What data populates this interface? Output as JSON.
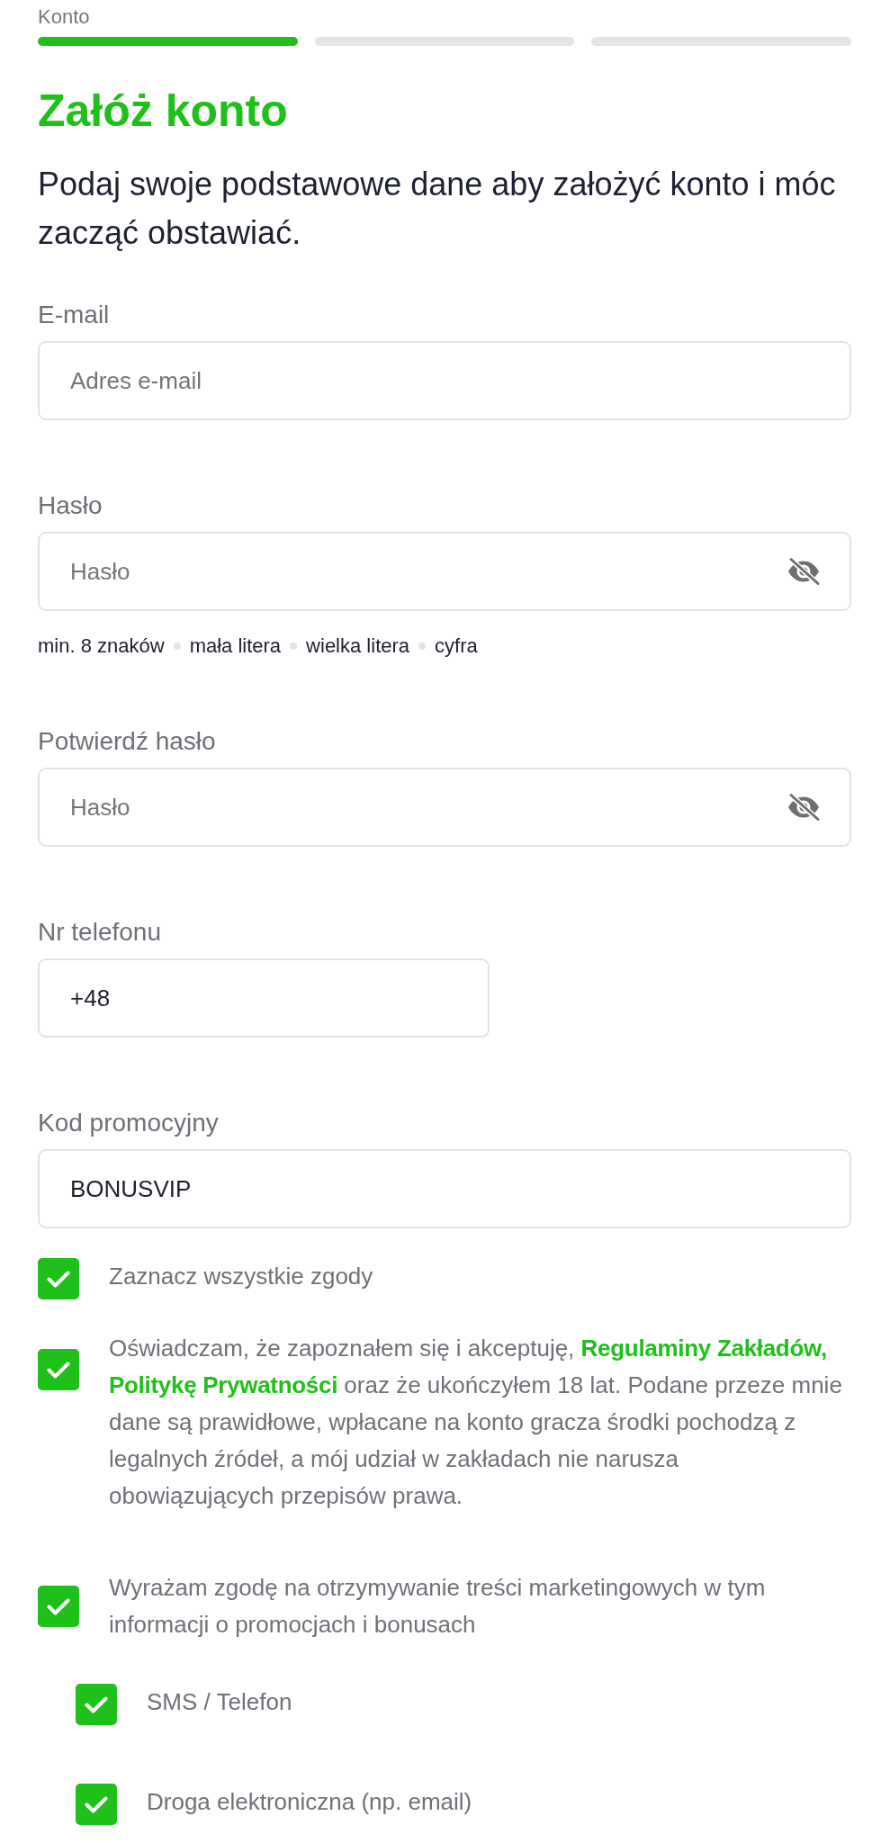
{
  "progress": {
    "label": "Konto",
    "steps": [
      {
        "active": true
      },
      {
        "active": false
      },
      {
        "active": false
      }
    ]
  },
  "title": "Załóż konto",
  "subtitle": "Podaj swoje podstawowe dane aby założyć konto i móc zacząć obstawiać.",
  "fields": [
    {
      "kind": "email",
      "label": "E-mail",
      "placeholder": "Adres e-mail"
    },
    {
      "kind": "password",
      "label": "Hasło",
      "placeholder": "Hasło",
      "hints": [
        "min. 8 znaków",
        "mała litera",
        "wielka litera",
        "cyfra"
      ]
    },
    {
      "kind": "password",
      "label": "Potwierdź hasło",
      "placeholder": "Hasło"
    },
    {
      "kind": "phone",
      "label": "Nr telefonu",
      "value": "+48"
    },
    {
      "kind": "code",
      "label": "Kod promocyjny",
      "value": "BONUSVIP"
    }
  ],
  "select_all": {
    "label": "Zaznacz wszystkie zgody",
    "checked": true
  },
  "consents": [
    {
      "checked": true,
      "segments": [
        {
          "kind": "text",
          "text": "Oświadczam, że zapoznałem się i akceptuję,"
        },
        {
          "kind": "link",
          "text": "Regulaminy Zakładów,"
        },
        {
          "kind": "link",
          "text": "Politykę Prywatności"
        },
        {
          "kind": "text",
          "text": "oraz że ukończyłem 18 lat. Podane przeze mnie dane są prawidłowe, wpłacane na konto gracza środki pochodzą z legalnych źródeł, a mój udział w zakładach nie narusza obowiązujących przepisów prawa."
        }
      ]
    },
    {
      "checked": true,
      "segments": [
        {
          "kind": "text",
          "text": "Wyrażam zgodę na otrzymywanie treści marketingowych w tym informacji o promocjach i bonusach"
        }
      ],
      "children": [
        {
          "label": "SMS / Telefon",
          "checked": true
        },
        {
          "label": "Droga elektroniczna (np. email)",
          "checked": true
        }
      ]
    }
  ]
}
